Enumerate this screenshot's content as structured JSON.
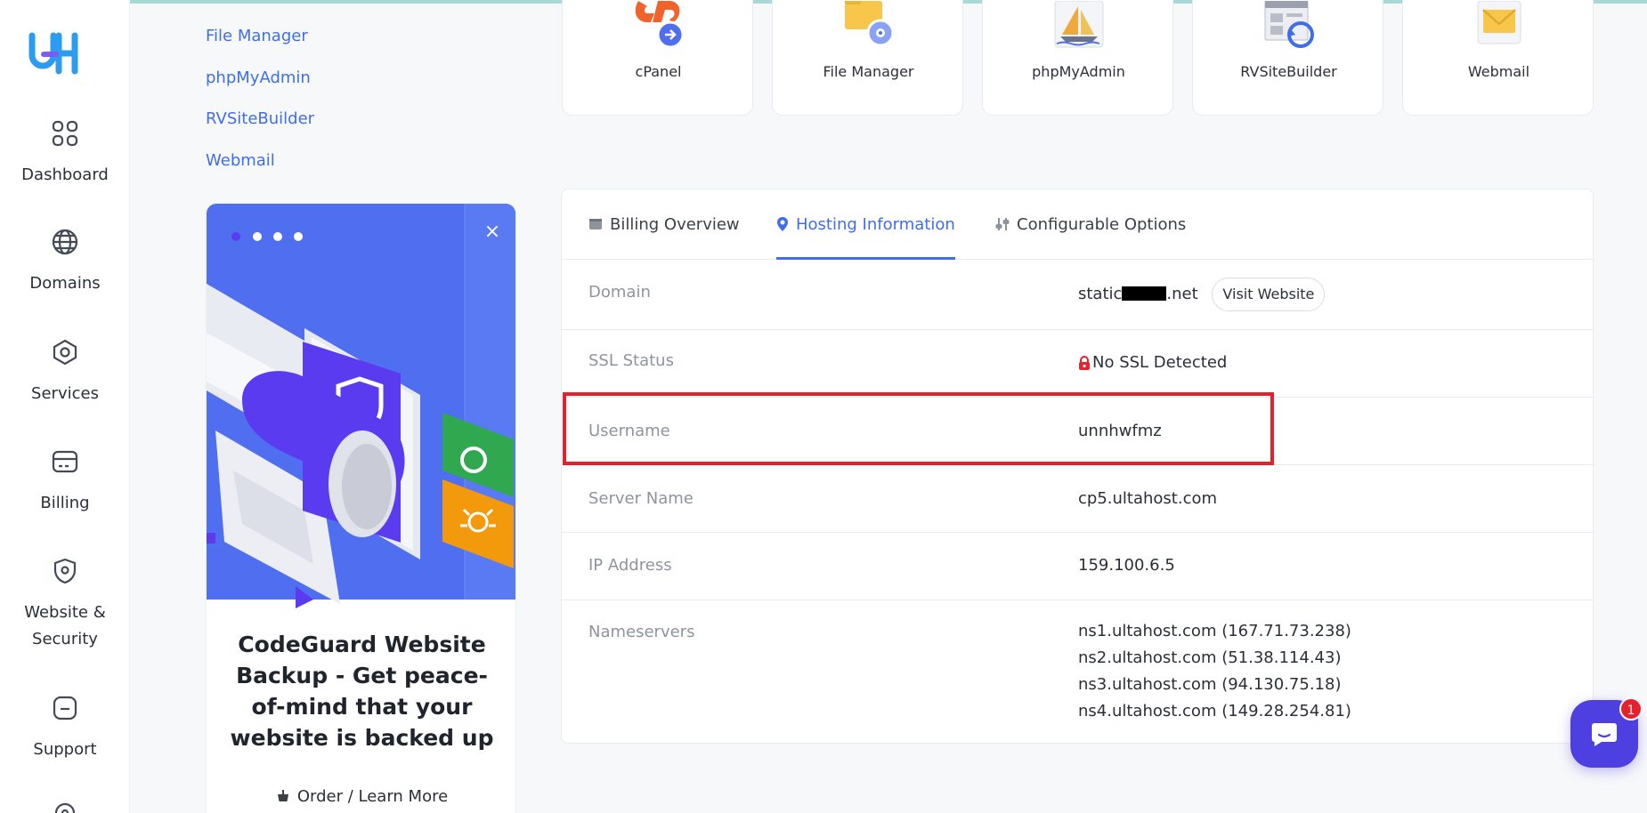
{
  "sidebar": {
    "items": [
      {
        "label": "Dashboard",
        "icon": "grid-icon"
      },
      {
        "label": "Domains",
        "icon": "globe-icon"
      },
      {
        "label": "Services",
        "icon": "hexagon-icon"
      },
      {
        "label": "Billing",
        "icon": "card-icon"
      },
      {
        "label": "Website &\nSecurity",
        "icon": "shield-icon"
      },
      {
        "label": "Support",
        "icon": "chat-square-icon"
      }
    ]
  },
  "links": [
    "File Manager",
    "phpMyAdmin",
    "RVSiteBuilder",
    "Webmail"
  ],
  "promo": {
    "close": "×",
    "title": "CodeGuard Website Backup - Get peace-of-mind that your website is backed up",
    "cta": "Order / Learn More"
  },
  "tiles": [
    {
      "label": "cPanel",
      "icon": "cpanel-icon"
    },
    {
      "label": "File Manager",
      "icon": "folder-icon"
    },
    {
      "label": "phpMyAdmin",
      "icon": "sailboat-icon"
    },
    {
      "label": "RVSiteBuilder",
      "icon": "sitebuilder-icon"
    },
    {
      "label": "Webmail",
      "icon": "envelope-icon"
    }
  ],
  "tabs": [
    {
      "label": "Billing Overview",
      "icon": "wallet-icon"
    },
    {
      "label": "Hosting Information",
      "icon": "location-pin-icon"
    },
    {
      "label": "Configurable Options",
      "icon": "sliders-icon"
    }
  ],
  "info": {
    "domain_label": "Domain",
    "domain_prefix": "static",
    "domain_suffix": ".net",
    "visit_button": "Visit Website",
    "ssl_label": "SSL Status",
    "ssl_value": "No SSL Detected",
    "username_label": "Username",
    "username_value": "unnhwfmz",
    "server_label": "Server Name",
    "server_value": "cp5.ultahost.com",
    "ip_label": "IP Address",
    "ip_value": "159.100.6.5",
    "ns_label": "Nameservers",
    "nameservers": [
      "ns1.ultahost.com (167.71.73.238)",
      "ns2.ultahost.com (51.38.114.43)",
      "ns3.ultahost.com (94.130.75.18)",
      "ns4.ultahost.com (149.28.254.81)"
    ]
  },
  "chat": {
    "badge": "1"
  },
  "colors": {
    "accent": "#3f6ee8",
    "highlight": "#e8202b",
    "chat": "#4d3fe0"
  }
}
